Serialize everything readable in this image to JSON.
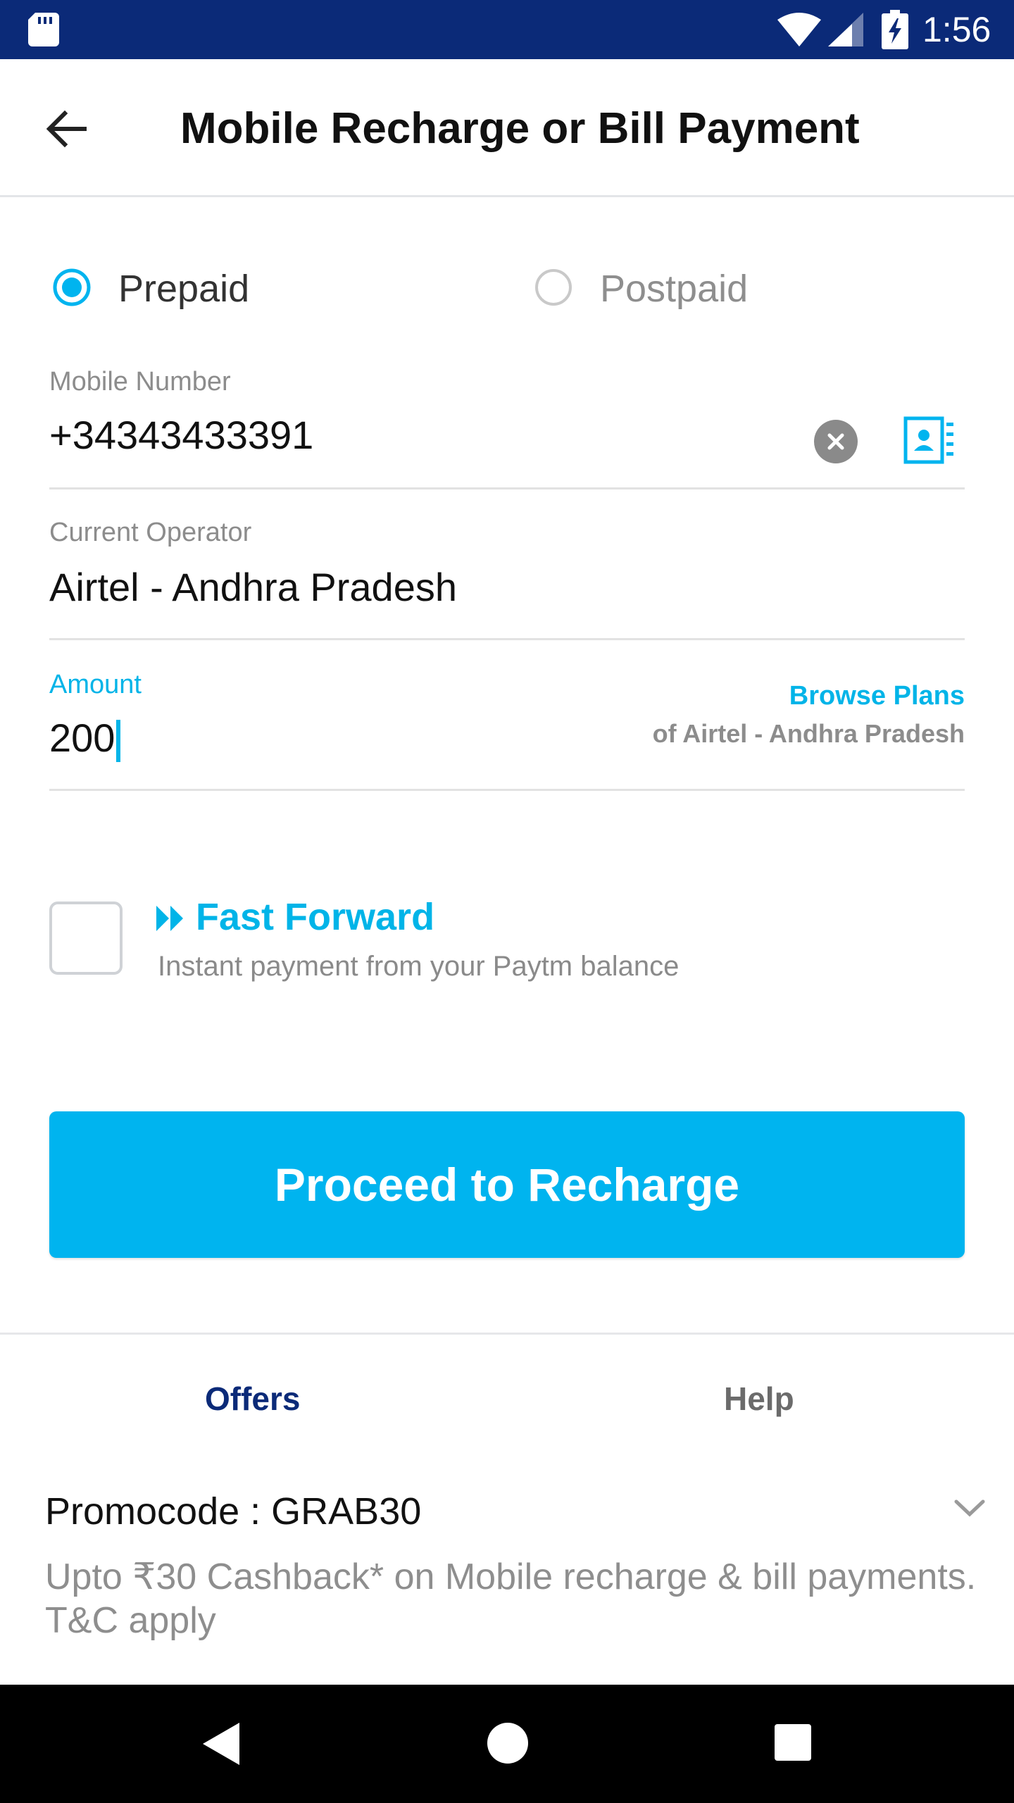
{
  "status_bar": {
    "time": "1:56",
    "icons": [
      "sd-card-icon",
      "wifi-icon",
      "signal-icon",
      "battery-charging-icon"
    ]
  },
  "header": {
    "title": "Mobile Recharge or Bill Payment",
    "back_icon": "arrow-left-icon"
  },
  "plan_type": {
    "options": [
      {
        "label": "Prepaid",
        "selected": true
      },
      {
        "label": "Postpaid",
        "selected": false
      }
    ]
  },
  "mobile": {
    "label": "Mobile Number",
    "value": "+34343433391",
    "clear_icon": "clear-icon",
    "contacts_icon": "contacts-icon"
  },
  "operator": {
    "label": "Current Operator",
    "value": "Airtel - Andhra Pradesh"
  },
  "amount": {
    "label": "Amount",
    "value": "200",
    "browse_label": "Browse Plans",
    "browse_sub": "of Airtel - Andhra Pradesh"
  },
  "fast_forward": {
    "title": "Fast Forward",
    "description": "Instant payment from your Paytm balance",
    "checked": false
  },
  "proceed": {
    "label": "Proceed to Recharge"
  },
  "tabs": [
    {
      "label": "Offers",
      "active": true
    },
    {
      "label": "Help",
      "active": false
    }
  ],
  "promo": {
    "title": "Promocode : GRAB30",
    "description": "Upto ₹30 Cashback* on Mobile recharge & bill payments. T&C apply"
  },
  "colors": {
    "accent": "#00b4ef",
    "status_bar": "#0b2a78",
    "tab_active": "#0b2a78"
  }
}
